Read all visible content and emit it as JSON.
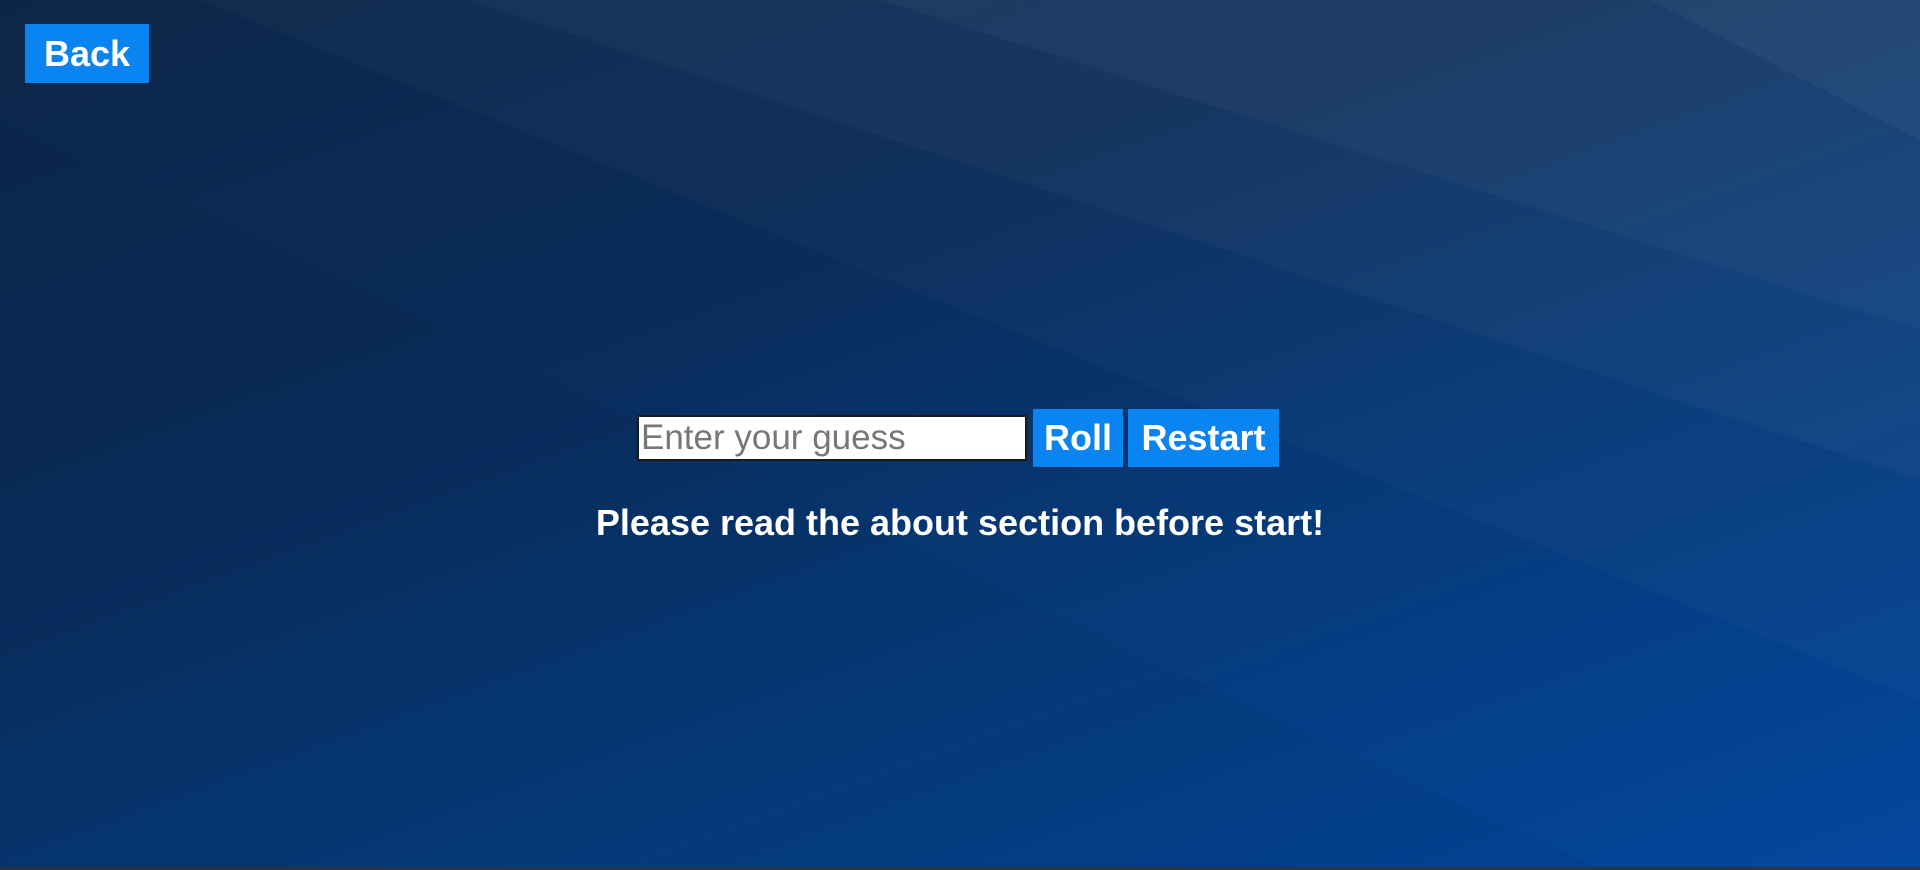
{
  "nav": {
    "back_label": "Back"
  },
  "game": {
    "guess_input": {
      "value": "",
      "placeholder": "Enter your guess"
    },
    "roll_label": "Roll",
    "restart_label": "Restart",
    "message": "Please read the about section before start!"
  },
  "colors": {
    "button_bg": "#0a84f0",
    "button_text": "#ffffff",
    "background_dark": "#0b2748",
    "background_light": "#03479e"
  }
}
